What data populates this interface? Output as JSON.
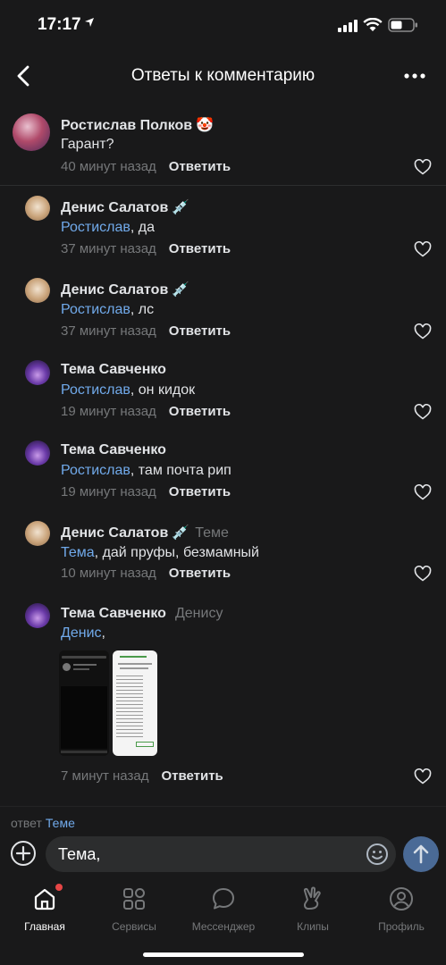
{
  "status_bar": {
    "time": "17:17"
  },
  "header": {
    "title": "Ответы к комментарию"
  },
  "root_comment": {
    "author": "Ростислав Полков",
    "author_emoji": "🤡",
    "text": "Гарант?",
    "time": "40 минут назад",
    "reply_label": "Ответить"
  },
  "replies": [
    {
      "author": "Денис Салатов",
      "author_emoji": "💉",
      "reply_to": "",
      "mention": "Ростислав",
      "text": ", да",
      "time": "37 минут назад",
      "reply_label": "Ответить"
    },
    {
      "author": "Денис Салатов",
      "author_emoji": "💉",
      "reply_to": "",
      "mention": "Ростислав",
      "text": ", лс",
      "time": "37 минут назад",
      "reply_label": "Ответить"
    },
    {
      "author": "Тема Савченко",
      "author_emoji": "",
      "reply_to": "",
      "mention": "Ростислав",
      "text": ", он кидок",
      "time": "19 минут назад",
      "reply_label": "Ответить"
    },
    {
      "author": "Тема Савченко",
      "author_emoji": "",
      "reply_to": "",
      "mention": "Ростислав",
      "text": ", там почта рип",
      "time": "19 минут назад",
      "reply_label": "Ответить"
    },
    {
      "author": "Денис Салатов",
      "author_emoji": "💉",
      "reply_to": "Теме",
      "mention": "Тема",
      "text": ", дай пруфы, безмамный",
      "time": "10 минут назад",
      "reply_label": "Ответить"
    },
    {
      "author": "Тема Савченко",
      "author_emoji": "",
      "reply_to": "Денису",
      "mention": "Денис",
      "text": ",",
      "time": "7 минут назад",
      "reply_label": "Ответить"
    }
  ],
  "reply_bar": {
    "label": "ответ",
    "target": "Теме"
  },
  "composer": {
    "value": "Тема,"
  },
  "tabs": [
    {
      "label": "Главная",
      "icon": "home-icon",
      "active": true
    },
    {
      "label": "Сервисы",
      "icon": "services-icon",
      "active": false
    },
    {
      "label": "Мессенджер",
      "icon": "messenger-icon",
      "active": false
    },
    {
      "label": "Клипы",
      "icon": "clips-icon",
      "active": false
    },
    {
      "label": "Профиль",
      "icon": "profile-icon",
      "active": false
    }
  ],
  "colors": {
    "background": "#19191a",
    "link": "#71aaeb",
    "muted": "#76787a",
    "send": "#4a6a96",
    "badge": "#e64646"
  }
}
